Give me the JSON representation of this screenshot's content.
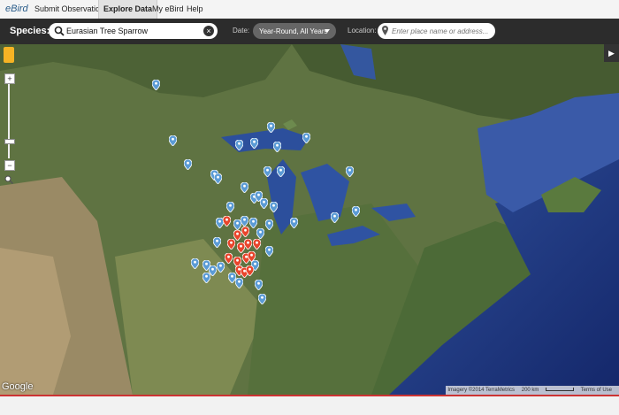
{
  "nav": {
    "logo": "eBird",
    "items": [
      {
        "label": "Submit Observations"
      },
      {
        "label": "Explore Data"
      },
      {
        "label": "My eBird"
      },
      {
        "label": "Help"
      }
    ]
  },
  "search": {
    "species_label": "Species:",
    "species_value": "Eurasian Tree Sparrow",
    "date_label": "Date:",
    "date_value": "Year-Round, All Years",
    "location_label": "Location:",
    "location_placeholder": "Enter place name or address..."
  },
  "map": {
    "google_logo": "Google",
    "attribution": "Imagery ©2014 TerraMetrics",
    "scale": "200 km",
    "terms": "Terms of Use",
    "marker_colors": {
      "blue": "#5b9bd5",
      "red": "#e8452c"
    }
  }
}
